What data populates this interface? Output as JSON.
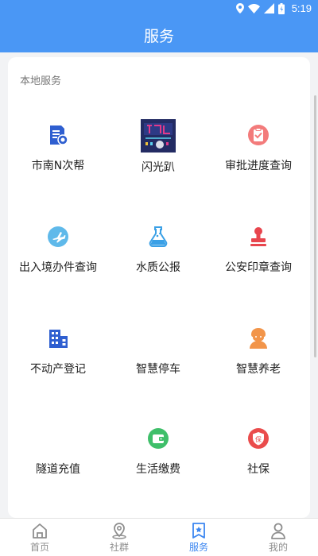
{
  "status_bar": {
    "time": "5:19",
    "icons": [
      "location-icon",
      "wifi-icon",
      "signal-icon",
      "battery-icon"
    ]
  },
  "header": {
    "title": "服务"
  },
  "section": {
    "title": "本地服务"
  },
  "services": [
    {
      "label": "市南N次帮",
      "icon": "document-badge-icon"
    },
    {
      "label": "闪光趴",
      "icon": "flash-party-logo"
    },
    {
      "label": "审批进度查询",
      "icon": "approval-check-icon"
    },
    {
      "label": "出入境办件查询",
      "icon": "airplane-icon"
    },
    {
      "label": "水质公报",
      "icon": "flask-icon"
    },
    {
      "label": "公安印章查询",
      "icon": "stamp-icon"
    },
    {
      "label": "不动产登记",
      "icon": "building-icon"
    },
    {
      "label": "智慧停车",
      "icon": "parking-car-icon"
    },
    {
      "label": "智慧养老",
      "icon": "elderly-icon"
    },
    {
      "label": "隧道充值",
      "icon": "tunnel-icon"
    },
    {
      "label": "生活缴费",
      "icon": "wallet-icon"
    },
    {
      "label": "社保",
      "icon": "insurance-shield-icon"
    }
  ],
  "tabs": [
    {
      "label": "首页",
      "icon": "home-icon"
    },
    {
      "label": "社群",
      "icon": "community-pin-icon"
    },
    {
      "label": "服务",
      "icon": "bookmark-star-icon",
      "active": true
    },
    {
      "label": "我的",
      "icon": "user-icon"
    }
  ],
  "colors": {
    "header_bg": "#4a97f5",
    "tab_active": "#3b86f0",
    "page_bg": "#f2f3f5"
  }
}
